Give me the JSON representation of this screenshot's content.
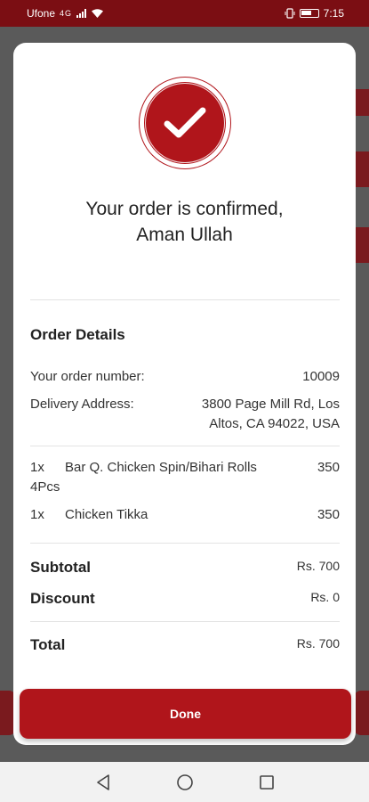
{
  "status_bar": {
    "carrier": "Ufone",
    "network": "4G",
    "time": "7:15"
  },
  "confirmation": {
    "title_line1": "Your order is confirmed,",
    "title_line2": "Aman Ullah"
  },
  "order_details": {
    "heading": "Order Details",
    "order_number_label": "Your order number:",
    "order_number": "10009",
    "address_label": "Delivery Address:",
    "address_line1": "3800 Page Mill Rd, Los",
    "address_line2": "Altos, CA 94022, USA"
  },
  "items": [
    {
      "qty": "1x",
      "name": "Bar Q. Chicken Spin/Bihari Rolls 4Pcs",
      "price": "350"
    },
    {
      "qty": "1x",
      "name": "Chicken Tikka",
      "price": "350"
    }
  ],
  "summary": {
    "subtotal_label": "Subtotal",
    "subtotal_value": "Rs. 700",
    "discount_label": "Discount",
    "discount_value": "Rs. 0",
    "total_label": "Total",
    "total_value": "Rs. 700"
  },
  "actions": {
    "done_label": "Done"
  },
  "colors": {
    "brand_red": "#b0151b",
    "status_bar": "#7b0e13"
  }
}
